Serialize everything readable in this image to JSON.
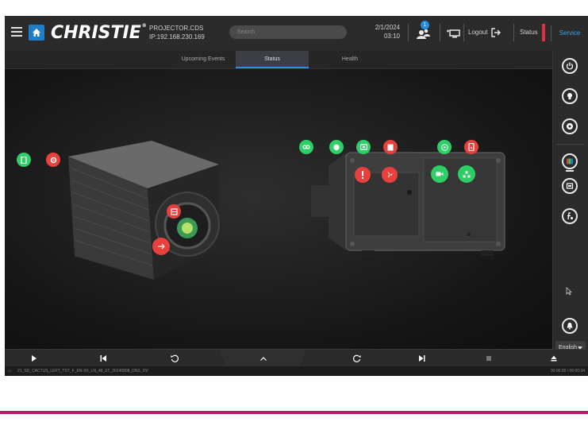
{
  "header": {
    "brand": "CHRISTIE",
    "projector_name": "PROJECTOR.CDS",
    "projector_ip": "IP:192.168.230.169",
    "search_placeholder": "Search",
    "date": "2/1/2024",
    "time": "03:10",
    "alert_count": "1",
    "logout_label": "Logout",
    "status_label": "Status",
    "service_label": "Service",
    "colors": {
      "accent": "#1f7ec8",
      "status": "#e0303d",
      "service": "#3da2e8"
    }
  },
  "tabs": [
    {
      "label": "Upcoming Events",
      "active": false
    },
    {
      "label": "Status",
      "active": true
    },
    {
      "label": "Health",
      "active": false
    }
  ],
  "rail": {
    "buttons": [
      "power-icon",
      "lamp-icon",
      "shutter-icon",
      "test-pattern-icon",
      "macro-icon",
      "function-icon"
    ],
    "alarm": "bell-icon",
    "language": "English"
  },
  "markers": {
    "colors": {
      "ok": "#2fce66",
      "error": "#e8403c"
    }
  },
  "bottom": {
    "controls": [
      "play-icon",
      "previous-icon",
      "rewind-icon",
      "expand-up-icon",
      "forward-icon",
      "next-icon",
      "stop-icon",
      "eject-icon"
    ],
    "file_name": "21_SD_CACTUS_LEFT_TST_F_EN-XX_LN_48_ST_20140808_DNS_OV",
    "timecode": "00:00:00 / 00:00:34"
  }
}
